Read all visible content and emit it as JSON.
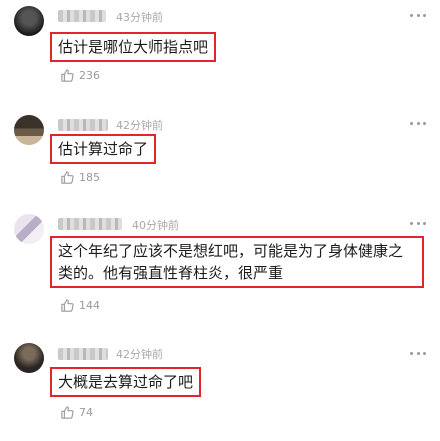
{
  "comments": [
    {
      "time": "43分钟前",
      "text": "估计是哪位大师指点吧",
      "likes": "236",
      "avatar_icon": "avatar-dark"
    },
    {
      "time": "42分钟前",
      "text": "估计算过命了",
      "likes": "185",
      "avatar_icon": "avatar-photo"
    },
    {
      "time": "40分钟前",
      "text": "这个年纪了应该不是想红吧，可能是为了身体健康之类的。他有强直性脊柱炎，很严重",
      "likes": "144",
      "avatar_icon": "avatar-light"
    },
    {
      "time": "42分钟前",
      "text": "大概是去算过命了吧",
      "likes": "74",
      "avatar_icon": "avatar-dark"
    }
  ],
  "colors": {
    "highlight_box": "#e0262b",
    "meta_text": "#a8a8a8"
  },
  "icons": {
    "more": "more-dots-icon",
    "like": "thumbs-up-icon"
  }
}
